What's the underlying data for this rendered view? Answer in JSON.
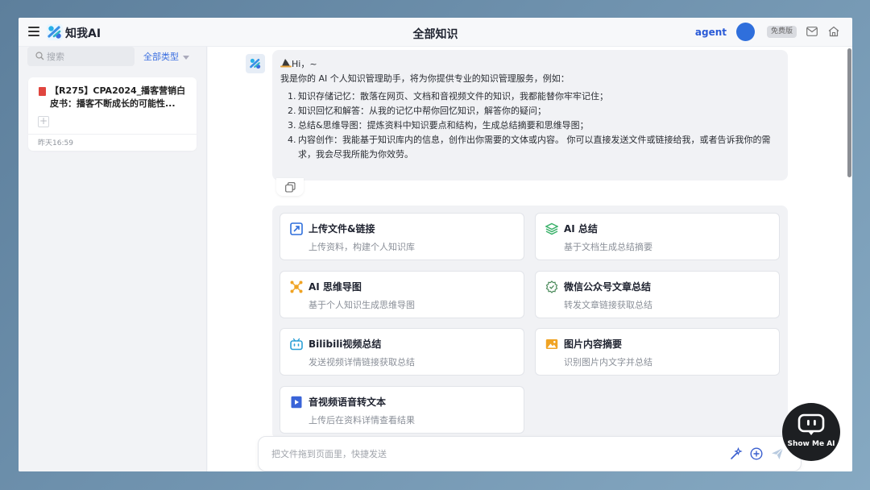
{
  "app": {
    "brand": "知我AI",
    "page_title": "全部知识"
  },
  "header": {
    "user_name": "agent",
    "plan_badge": "免费版"
  },
  "sidebar": {
    "search_placeholder": "搜索",
    "type_filter": "全部类型",
    "documents": [
      {
        "title": "【R275】CPA2024_播客营销白皮书：播客不断成长的可能性...",
        "add_label": "+",
        "time": "昨天16:59"
      }
    ]
  },
  "chat": {
    "greeting": "Hi，~",
    "greeting_icon": "witch-hat-icon",
    "intro": "我是你的 AI 个人知识管理助手，将为你提供专业的知识管理服务，例如：",
    "items": [
      {
        "num": "1.",
        "text": "知识存储记忆：散落在网页、文档和音视频文件的知识，我都能替你牢牢记住；"
      },
      {
        "num": "2.",
        "text": "知识回忆和解答：从我的记忆中帮你回忆知识，解答你的疑问；"
      },
      {
        "num": "3.",
        "text": "总结&思维导图：提炼资料中知识要点和结构，生成总结摘要和思维导图；"
      },
      {
        "num": "4.",
        "text": "内容创作：我能基于知识库内的信息，创作出你需要的文体或内容。 你可以直接发送文件或链接给我，或者告诉我你的需求，我会尽我所能为你效劳。"
      }
    ]
  },
  "tools": [
    {
      "title": "上传文件&链接",
      "desc": "上传资料，构建个人知识库",
      "icon": "upload-link-icon",
      "color": "#2f6fdc"
    },
    {
      "title": "AI 总结",
      "desc": "基于文档生成总结摘要",
      "icon": "layers-icon",
      "color": "#3bb26b"
    },
    {
      "title": "AI 思维导图",
      "desc": "基于个人知识生成思维导图",
      "icon": "mindmap-icon",
      "color": "#f0a323"
    },
    {
      "title": "微信公众号文章总结",
      "desc": "转发文章链接获取总结",
      "icon": "wechat-article-icon",
      "color": "#4a8a5a"
    },
    {
      "title": "Bilibili视频总结",
      "desc": "发送视频详情链接获取总结",
      "icon": "bilibili-icon",
      "color": "#2a9fd6"
    },
    {
      "title": "图片内容摘要",
      "desc": "识别图片内文字并总结",
      "icon": "image-icon",
      "color": "#f0a323"
    },
    {
      "title": "音视频语音转文本",
      "desc": "上传后在资料详情查看结果",
      "icon": "video-transcribe-icon",
      "color": "#3a64d8"
    }
  ],
  "composer": {
    "placeholder": "把文件拖到页面里，快捷发送"
  },
  "watermark": {
    "text": "Show Me AI"
  }
}
